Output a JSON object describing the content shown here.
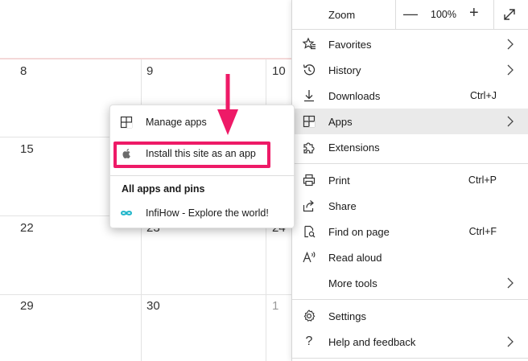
{
  "calendar": {
    "rows": [
      [
        "8",
        "9",
        "10"
      ],
      [
        "15",
        "",
        ""
      ],
      [
        "22",
        "23",
        "24"
      ],
      [
        "29",
        "30",
        "1"
      ]
    ]
  },
  "menu": {
    "zoom": {
      "label": "Zoom",
      "minus": "—",
      "value": "100%",
      "plus": "+"
    },
    "items": [
      {
        "label": "Favorites",
        "shortcut": "",
        "icon": "favorites-icon",
        "submenu": true
      },
      {
        "label": "History",
        "shortcut": "",
        "icon": "history-icon",
        "submenu": true
      },
      {
        "label": "Downloads",
        "shortcut": "Ctrl+J",
        "icon": "download-icon",
        "submenu": false
      },
      {
        "label": "Apps",
        "shortcut": "",
        "icon": "apps-icon",
        "submenu": true,
        "active": true
      },
      {
        "label": "Extensions",
        "shortcut": "",
        "icon": "extensions-icon",
        "submenu": false
      },
      {
        "label": "Print",
        "shortcut": "Ctrl+P",
        "icon": "print-icon",
        "submenu": false
      },
      {
        "label": "Share",
        "shortcut": "",
        "icon": "share-icon",
        "submenu": false
      },
      {
        "label": "Find on page",
        "shortcut": "Ctrl+F",
        "icon": "find-icon",
        "submenu": false
      },
      {
        "label": "Read aloud",
        "shortcut": "",
        "icon": "read-aloud-icon",
        "submenu": false
      },
      {
        "label": "More tools",
        "shortcut": "",
        "icon": "",
        "submenu": true
      },
      {
        "label": "Settings",
        "shortcut": "",
        "icon": "gear-icon",
        "submenu": false
      },
      {
        "label": "Help and feedback",
        "shortcut": "",
        "icon": "help-icon",
        "submenu": true
      }
    ]
  },
  "apps_submenu": {
    "manage": "Manage apps",
    "install": "Install this site as an app",
    "heading": "All apps and pins",
    "app_item": "InfiHow - Explore the world!"
  },
  "colors": {
    "highlight": "#ee1a67",
    "active_row": "#eaeaea",
    "infihow_logo": "#1fb5c9"
  }
}
